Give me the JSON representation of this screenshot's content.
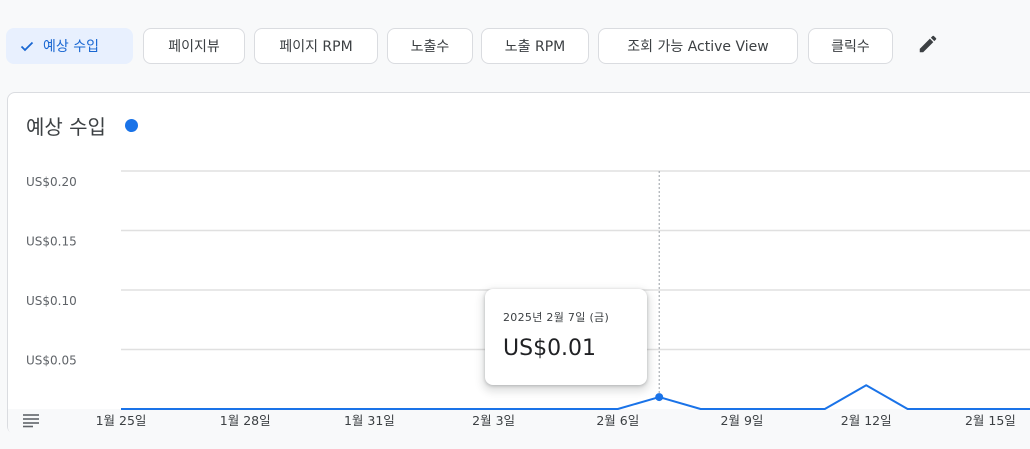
{
  "metric_chips": [
    {
      "label": "예상 수입",
      "selected": true
    },
    {
      "label": "페이지뷰",
      "selected": false
    },
    {
      "label": "페이지 RPM",
      "selected": false
    },
    {
      "label": "노출수",
      "selected": false
    },
    {
      "label": "노출 RPM",
      "selected": false
    },
    {
      "label": "조회 가능 Active View",
      "selected": false
    },
    {
      "label": "클릭수",
      "selected": false
    }
  ],
  "icons": {
    "check": "check-icon",
    "edit": "pencil-icon",
    "menu": "menu-lines-icon"
  },
  "card": {
    "title": "예상 수입"
  },
  "tooltip": {
    "date": "2025년 2월 7일 (금)",
    "value": "US$0.01"
  },
  "colors": {
    "accent": "#1a73e8",
    "chip_selected_bg": "#e8f0fe",
    "chip_selected_text": "#1967d2"
  },
  "chart_data": {
    "type": "line",
    "title": "예상 수입",
    "x_tick_labels": [
      "1월 25일",
      "1월 28일",
      "1월 31일",
      "2월 3일",
      "2월 6일",
      "2월 9일",
      "2월 12일",
      "2월 15일"
    ],
    "y_tick_labels": [
      "US$0.05",
      "US$0.10",
      "US$0.15",
      "US$0.20"
    ],
    "y_ticks": [
      0.05,
      0.1,
      0.15,
      0.2
    ],
    "ylim": [
      0,
      0.2
    ],
    "grid": true,
    "series": [
      {
        "name": "예상 수입",
        "x": [
          "1월 25일",
          "1월 26일",
          "1월 27일",
          "1월 28일",
          "1월 29일",
          "1월 30일",
          "1월 31일",
          "2월 1일",
          "2월 2일",
          "2월 3일",
          "2월 4일",
          "2월 5일",
          "2월 6일",
          "2월 7일",
          "2월 8일",
          "2월 9일",
          "2월 10일",
          "2월 11일",
          "2월 12일",
          "2월 13일",
          "2월 14일",
          "2월 15일",
          "2월 16일"
        ],
        "y": [
          0,
          0,
          0,
          0,
          0,
          0,
          0,
          0,
          0,
          0,
          0,
          0,
          0,
          0.01,
          0,
          0,
          0,
          0,
          0.02,
          0,
          0,
          0,
          0
        ]
      }
    ],
    "highlight": {
      "x": "2월 7일",
      "y": 0.01
    }
  }
}
